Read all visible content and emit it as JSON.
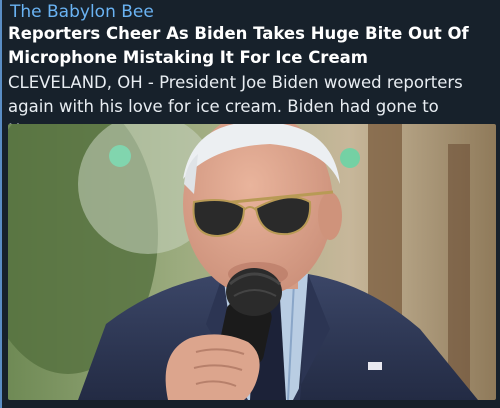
{
  "link_preview": {
    "site_name": "The Babylon Bee",
    "title": "Reporters Cheer As Biden Takes Huge Bite Out Of Microphone Mistaking It For Ice Cream",
    "description": "CLEVELAND, OH - President Joe Biden wowed reporters again with his love for ice cream. Biden had gone to Honey...",
    "accent_color": "#6ab3f3",
    "background_color": "#17212b"
  }
}
